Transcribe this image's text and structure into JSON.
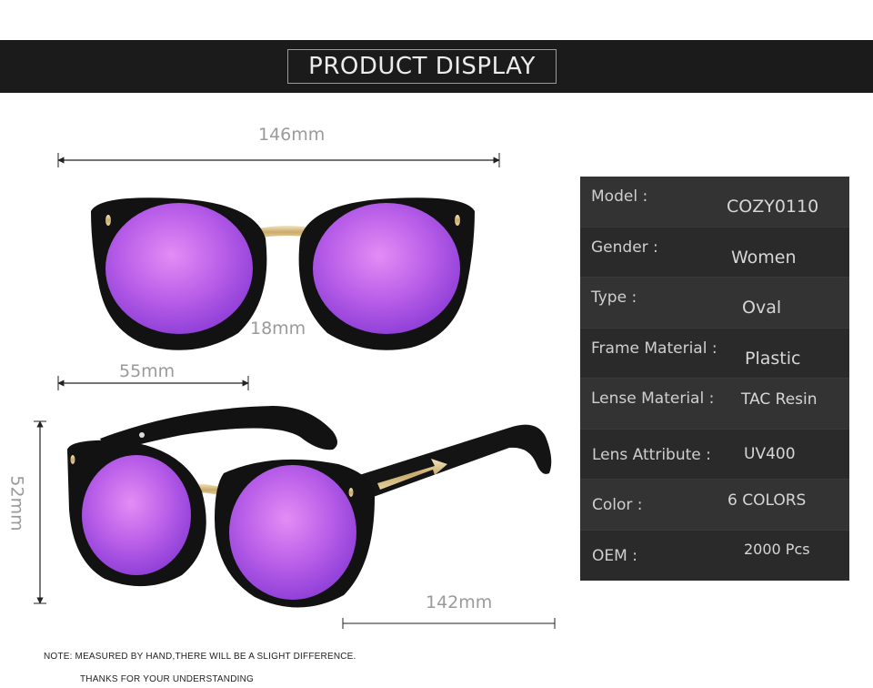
{
  "header": {
    "title": "PRODUCT DISPLAY"
  },
  "dimensions": {
    "total_width": "146mm",
    "bridge": "18mm",
    "lens_width": "55mm",
    "lens_height": "52mm",
    "temple_length": "142mm"
  },
  "specs": [
    {
      "label": "Model :",
      "value": "COZY0110"
    },
    {
      "label": "Gender :",
      "value": "Women"
    },
    {
      "label": "Type :",
      "value": "Oval"
    },
    {
      "label": "Frame Material :",
      "value": "Plastic"
    },
    {
      "label": "Lense Material :",
      "value": "TAC Resin"
    },
    {
      "label": "Lens Attribute :",
      "value": "UV400"
    },
    {
      "label": "Color :",
      "value": "6 COLORS"
    },
    {
      "label": "OEM :",
      "value": "2000 Pcs"
    }
  ],
  "notes": {
    "line1": "NOTE: MEASURED BY HAND,THERE WILL BE A SLIGHT DIFFERENCE.",
    "line2": "THANKS FOR YOUR UNDERSTANDING"
  },
  "colors": {
    "lens": "#b35ae6",
    "frame": "#111111",
    "header_bg": "#1b1b1b",
    "table_bg": "#2e2e2e"
  }
}
